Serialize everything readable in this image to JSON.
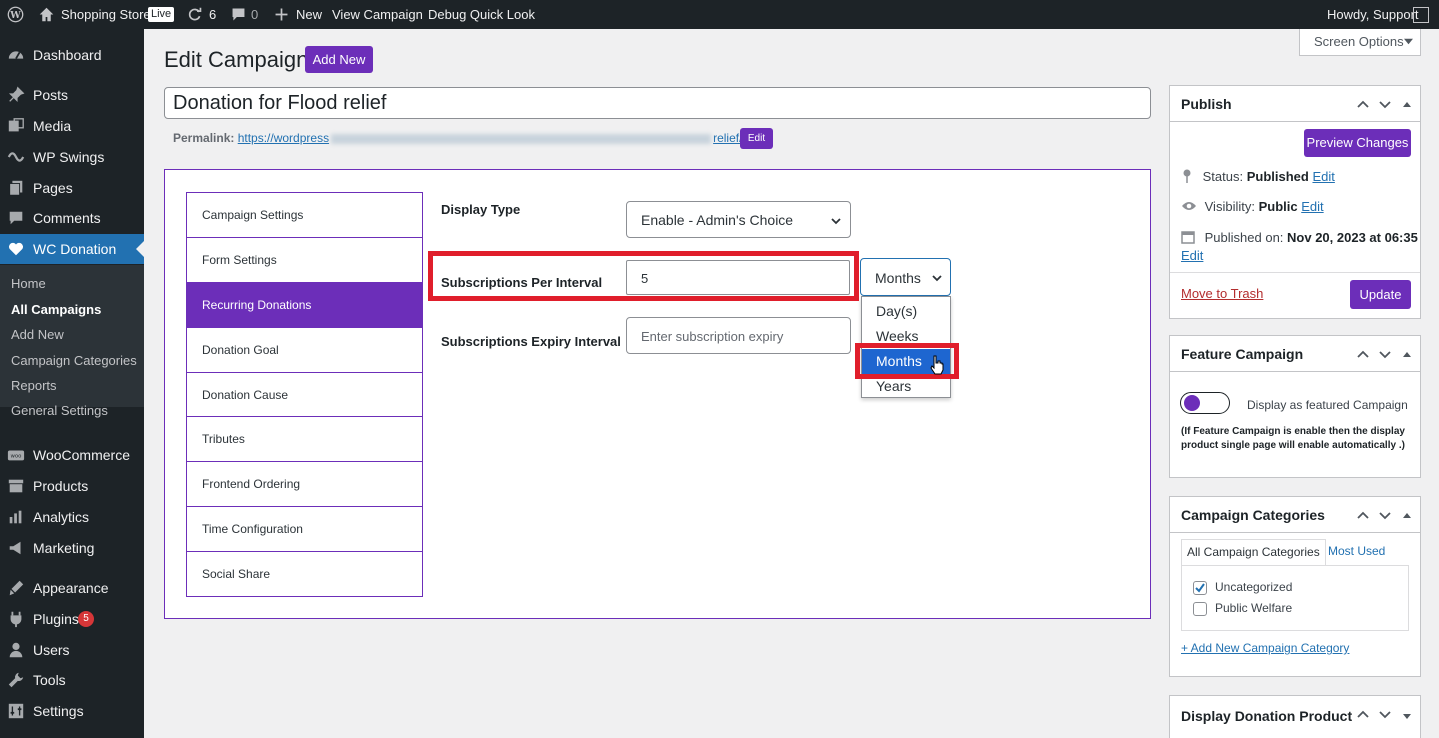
{
  "admin_bar": {
    "site_name": "Shopping Store",
    "live_badge": "Live",
    "updates_count": "6",
    "comments_count": "0",
    "new_label": "New",
    "view_campaign": "View Campaign",
    "debug": "Debug Quick Look",
    "greeting": "Howdy, Support"
  },
  "sidebar": {
    "items": [
      {
        "label": "Dashboard",
        "icon": "dashboard-icon"
      },
      {
        "label": "Posts",
        "icon": "pin-icon"
      },
      {
        "label": "Media",
        "icon": "media-icon"
      },
      {
        "label": "WP Swings",
        "icon": "swings-icon"
      },
      {
        "label": "Pages",
        "icon": "pages-icon"
      },
      {
        "label": "Comments",
        "icon": "comment-icon"
      },
      {
        "label": "WC Donation",
        "icon": "heart-icon"
      },
      {
        "label": "WooCommerce",
        "icon": "woo-icon"
      },
      {
        "label": "Products",
        "icon": "archive-icon"
      },
      {
        "label": "Analytics",
        "icon": "bar-chart-icon"
      },
      {
        "label": "Marketing",
        "icon": "megaphone-icon"
      },
      {
        "label": "Appearance",
        "icon": "brush-icon"
      },
      {
        "label": "Plugins",
        "icon": "plugin-icon",
        "badge": "5"
      },
      {
        "label": "Users",
        "icon": "users-icon"
      },
      {
        "label": "Tools",
        "icon": "wrench-icon"
      },
      {
        "label": "Settings",
        "icon": "settings-icon"
      }
    ],
    "submenu": [
      "Home",
      "All Campaigns",
      "Add New",
      "Campaign Categories",
      "Reports",
      "General Settings"
    ]
  },
  "screen_options": "Screen Options",
  "page": {
    "title": "Edit Campaign",
    "add_new": "Add New",
    "campaign_title": "Donation for Flood relief",
    "permalink_label": "Permalink:",
    "permalink_start": "https://wordpress",
    "permalink_end": "relief/",
    "permalink_edit": "Edit"
  },
  "tabs": [
    "Campaign Settings",
    "Form Settings",
    "Recurring Donations",
    "Donation Goal",
    "Donation Cause",
    "Tributes",
    "Frontend Ordering",
    "Time Configuration",
    "Social Share"
  ],
  "fields": {
    "display_type_label": "Display Type",
    "display_type_value": "Enable - Admin's Choice",
    "per_interval_label": "Subscriptions Per Interval",
    "per_interval_value": "5",
    "interval_unit": "Months",
    "expiry_label": "Subscriptions Expiry Interval",
    "expiry_placeholder": "Enter subscription expiry"
  },
  "dropdown_options": [
    "Day(s)",
    "Weeks",
    "Months",
    "Years"
  ],
  "publish": {
    "title": "Publish",
    "preview": "Preview Changes",
    "status_label": "Status:",
    "status_value": "Published",
    "visibility_label": "Visibility:",
    "visibility_value": "Public",
    "published_label": "Published on:",
    "published_value": "Nov 20, 2023 at 06:35",
    "edit": "Edit",
    "trash": "Move to Trash",
    "update": "Update"
  },
  "feature": {
    "title": "Feature Campaign",
    "toggle_label": "Display as featured Campaign",
    "note": "(If Feature Campaign is enable then the display product single page will enable automatically .)"
  },
  "categories": {
    "title": "Campaign Categories",
    "tab_all": "All Campaign Categories",
    "tab_most": "Most Used",
    "items": [
      {
        "label": "Uncategorized",
        "checked": true
      },
      {
        "label": "Public Welfare",
        "checked": false
      }
    ],
    "add_new": "+ Add New Campaign Category"
  },
  "display_product": {
    "title": "Display Donation Product"
  },
  "colors": {
    "accent_purple": "#6c2eb9",
    "highlight_red": "#e01e2b",
    "wp_blue": "#2271b1",
    "selected_blue": "#1e66d0"
  }
}
